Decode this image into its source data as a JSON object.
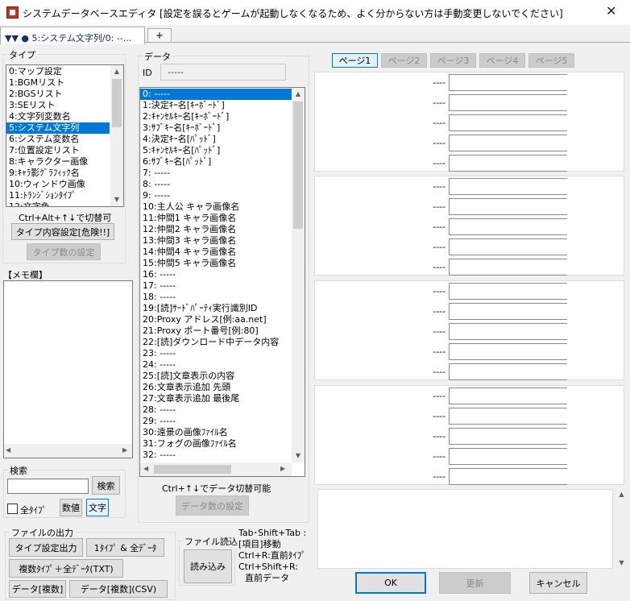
{
  "window": {
    "title": "システムデータベースエディタ [設定を誤るとゲームが起動しなくなるため、よく分からない方は手動変更しないでください]",
    "close": "✕"
  },
  "tabs": {
    "current": "▼▼ ● 5:システム文字列/0: --...",
    "add": "+"
  },
  "type_panel": {
    "label": "タイプ",
    "items": [
      "0:マップ設定",
      "1:BGMリスト",
      "2:BGSリスト",
      "3:SEリスト",
      "4:文字列変数名",
      "5:システム文字列",
      "6:システム変数名",
      "7:位置設定リスト",
      "8:キャラクター画像",
      "9:ｷｬﾗ影ｸﾞﾗﾌｨｯｸ名",
      "10:ウィンドウ画像",
      "11:ﾄﾗﾝｼﾞｼｮﾝﾀｲﾌﾟ",
      "12:文字色"
    ],
    "selected_index": 5,
    "hint": "Ctrl+Alt+↑↓で切替可",
    "content_btn": "タイプ内容設定[危険!!]",
    "count_btn": "タイプ数の設定"
  },
  "memo": {
    "label": "【メモ欄】"
  },
  "search": {
    "label": "検索",
    "button": "検索",
    "all_types": "全ﾀｲﾌﾟ",
    "numeric": "数値",
    "text": "文字"
  },
  "file_output": {
    "label": "ファイルの出力",
    "btn1": "タイプ設定出力",
    "btn2": "1ﾀｲﾌﾟ & 全ﾃﾞｰﾀ",
    "btn3": "複数ﾀｲﾌﾟ＋全ﾃﾞｰﾀ(TXT)",
    "btn4": "データ[複数]",
    "btn5": "データ[複数](CSV)"
  },
  "file_read": {
    "label": "ファイル読込",
    "button": "読み込み"
  },
  "shortcut_help": {
    "line1": "Tab･Shift+Tab :",
    "line2": "[項目]移動",
    "line3": "Ctrl+R:直前ﾀｲﾌﾟ",
    "line4": "Ctrl+Shift+R:",
    "line5": "直前データ"
  },
  "data_panel": {
    "label": "データ",
    "id_label": "ID",
    "id_value": "-----",
    "items": [
      "0: -----",
      "1:決定ｷｰ名[ｷｰﾎﾞｰﾄﾞ]",
      "2:ｷｬﾝｾﾙｷｰ名[ｷｰﾎﾞｰﾄﾞ]",
      "3:ｻﾌﾞｷｰ名[ｷｰﾎﾞｰﾄﾞ]",
      "4:決定ｷｰ名[ﾊﾟｯﾄﾞ]",
      "5:ｷｬﾝｾﾙｷｰ名[ﾊﾟｯﾄﾞ]",
      "6:ｻﾌﾞｷｰ名[ﾊﾟｯﾄﾞ]",
      "7: -----",
      "8: -----",
      "9: -----",
      "10:主人公 キャラ画像名",
      "11:仲間1 キャラ画像名",
      "12:仲間2 キャラ画像名",
      "13:仲間3 キャラ画像名",
      "14:仲間4 キャラ画像名",
      "15:仲間5 キャラ画像名",
      "16: -----",
      "17: -----",
      "18: -----",
      "19:[読]ｻｰﾄﾞﾊﾟｰﾃｨ実行識別ID",
      "20:Proxy アドレス[例:aa.net]",
      "21:Proxy ポート番号[例:80]",
      "22:[読]ダウンロード中データ内容",
      "23: -----",
      "24: -----",
      "25:[読]文章表示の内容",
      "26:文章表示追加 先頭",
      "27:文章表示追加 最後尾",
      "28: -----",
      "29: -----",
      "30:遠景の画像ﾌｧｲﾙ名",
      "31:フォグの画像ﾌｧｲﾙ名",
      "32: -----"
    ],
    "selected_index": 0,
    "hint": "Ctrl+↑↓でデータ切替可能",
    "count_btn": "データ数の設定"
  },
  "pages": {
    "items": [
      "ページ1",
      "ページ2",
      "ページ3",
      "ページ4",
      "ページ5"
    ],
    "active_index": 0
  },
  "field_label": "----",
  "dialog": {
    "ok": "OK",
    "apply": "更新",
    "cancel": "キャンセル"
  }
}
